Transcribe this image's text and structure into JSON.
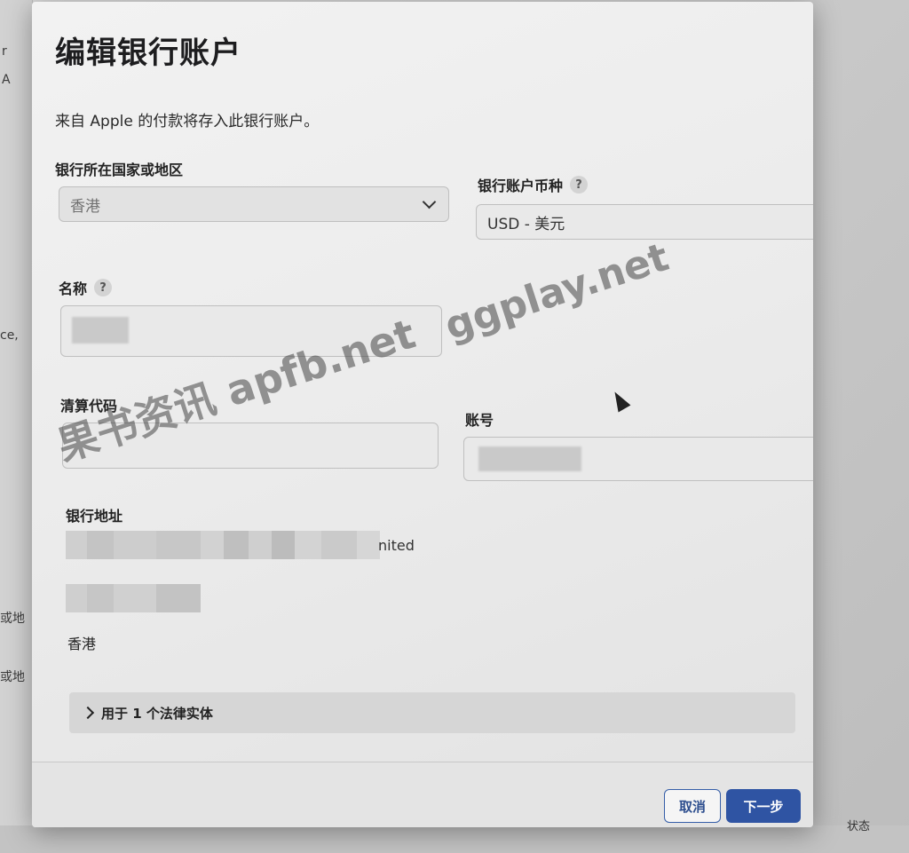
{
  "background": {
    "left_fragments": [
      "r",
      "A",
      "ce,",
      "或地",
      "或地"
    ],
    "status_label": "状态"
  },
  "dialog": {
    "title": "编辑银行账户",
    "subtitle": "来自 Apple 的付款将存入此银行账户。",
    "country": {
      "label": "银行所在国家或地区",
      "value": "香港"
    },
    "currency": {
      "label": "银行账户币种",
      "help": "?",
      "value": "USD - 美元"
    },
    "name": {
      "label": "名称",
      "help": "?"
    },
    "clearing_code": {
      "label": "清算代码"
    },
    "account_number": {
      "label": "账号"
    },
    "bank_address": {
      "label": "银行地址",
      "line1_visible_suffix": "nited",
      "region": "香港"
    },
    "legal_entities": {
      "label": "用于 1 个法律实体"
    },
    "buttons": {
      "cancel": "取消",
      "next": "下一步"
    }
  },
  "watermarks": [
    "果书资讯 apfb.net",
    "ggplay.net"
  ],
  "colors": {
    "primary_button": "#2f54a3",
    "dialog_bg": "#ececec"
  }
}
